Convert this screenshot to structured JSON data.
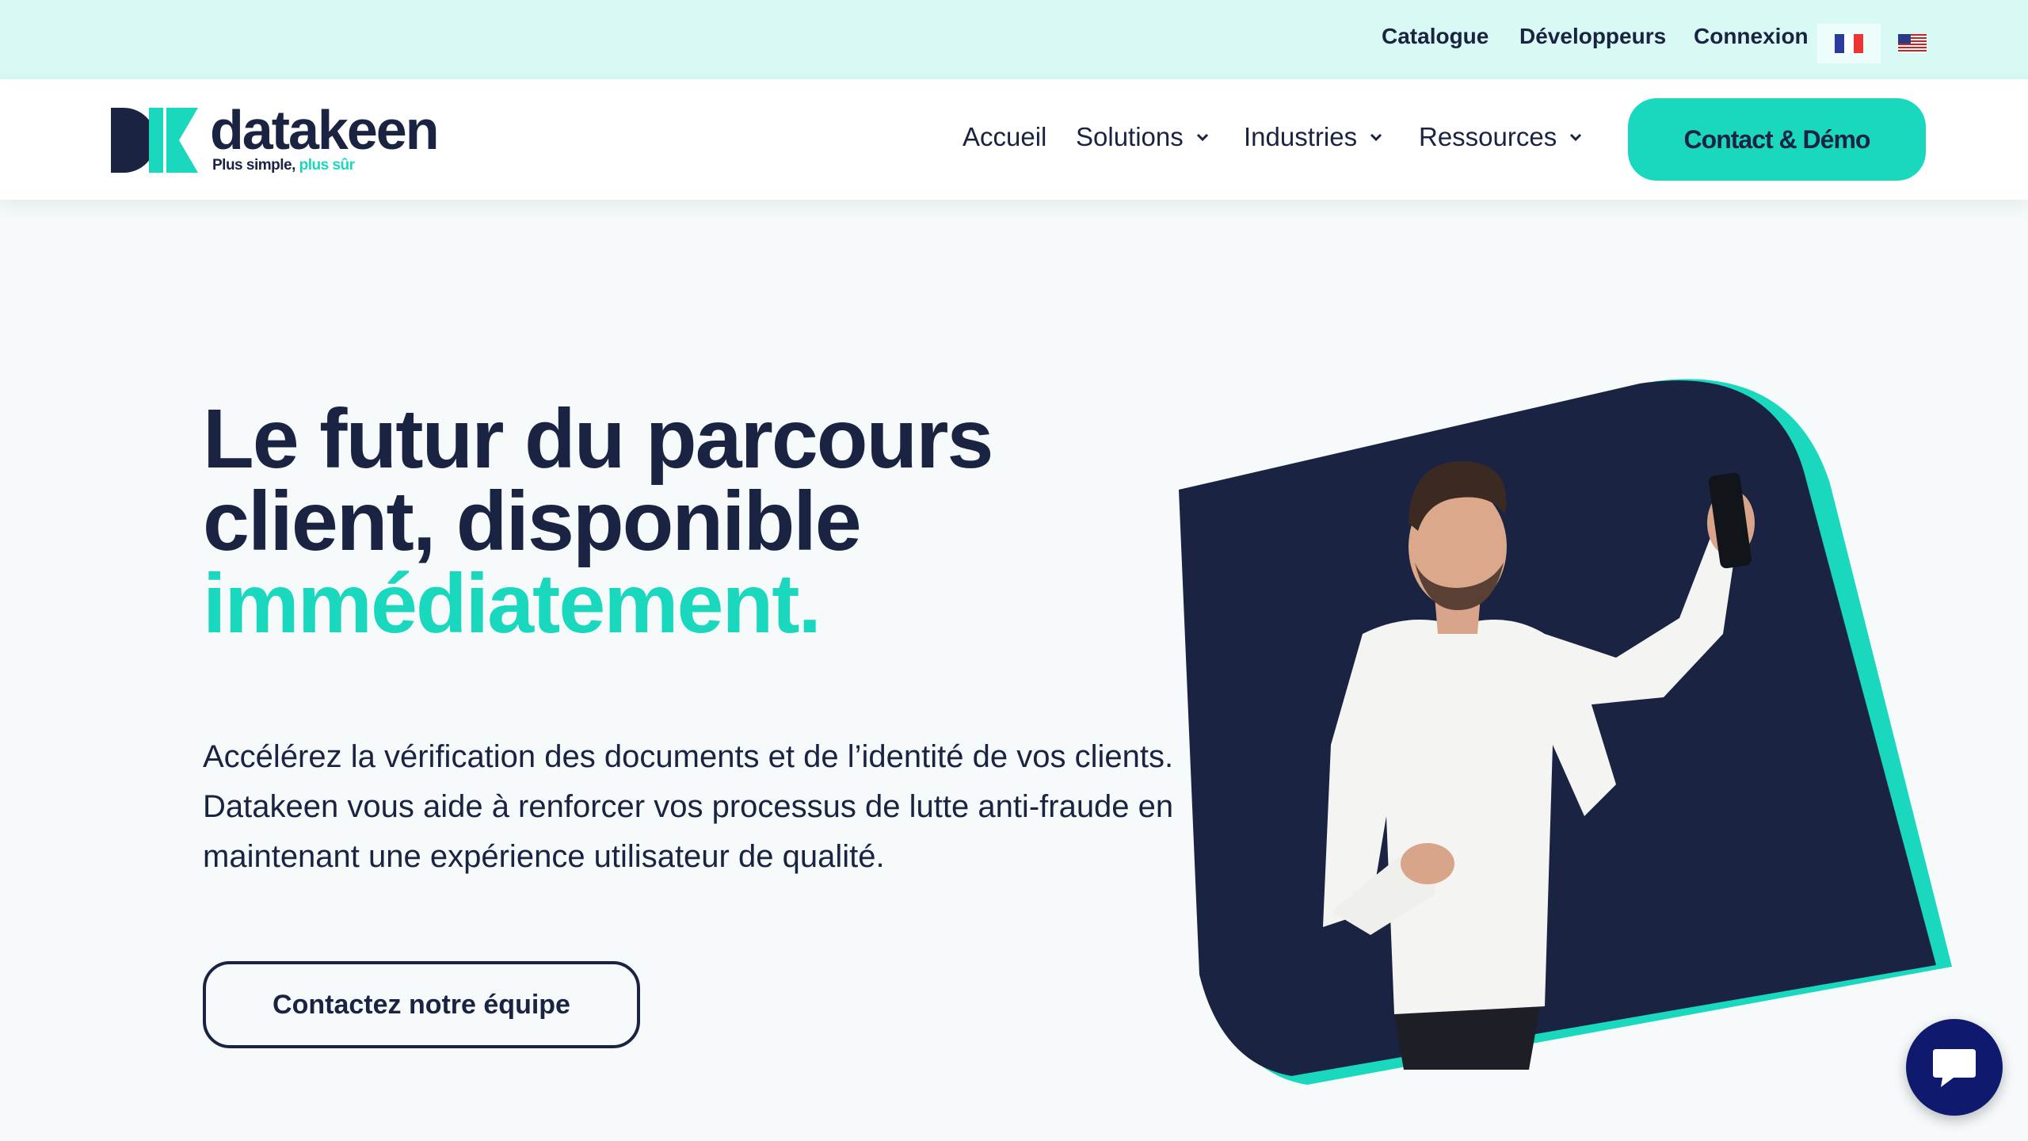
{
  "topbar": {
    "links": [
      "Catalogue",
      "Développeurs",
      "Connexion"
    ],
    "flags": [
      "fr-flag-icon",
      "us-flag-icon"
    ]
  },
  "header": {
    "logo": {
      "word": "datakeen",
      "tagline": "Plus simple,",
      "tagline_accent": "plus sûr"
    },
    "nav": {
      "accueil": "Accueil",
      "solutions": "Solutions",
      "industries": "Industries",
      "ressources": "Ressources"
    },
    "cta": "Contact & Démo"
  },
  "hero": {
    "title_line1": "Le futur du parcours",
    "title_line2": "client, disponible",
    "title_accent": "immédiatement.",
    "description": "Accélérez la vérification des documents et de l’identité de vos clients. Datakeen vous aide à renforcer vos processus de lutte anti-fraude en maintenant une expérience utilisateur de qualité.",
    "button": "Contactez notre équipe"
  },
  "chat": {
    "icon": "chat-bubble-icon"
  },
  "colors": {
    "accent": "#1ad8bd",
    "navy": "#1a2342",
    "topbar_bg": "#d8f9f4",
    "page_bg": "#f6fafa",
    "chat_bg": "#0f1a6e"
  }
}
